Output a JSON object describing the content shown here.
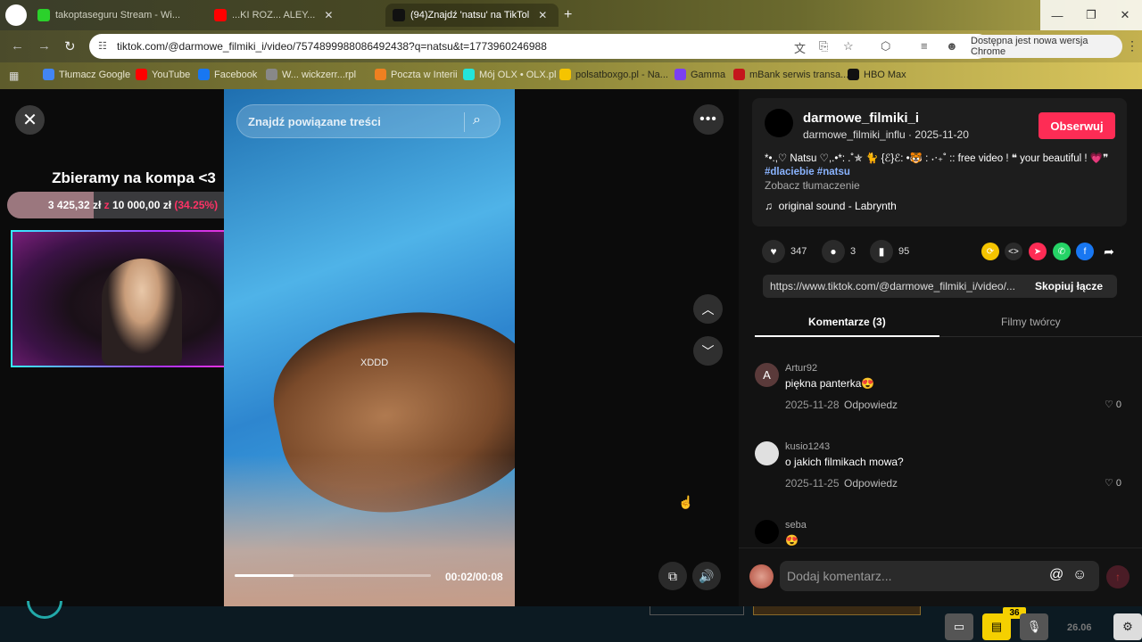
{
  "browser": {
    "tabs": [
      {
        "title": "takoptaseguru Stream - Wi...",
        "fav_color": "#2bd12b"
      },
      {
        "title": "...KI ROZ... ALEY...",
        "fav_color": "#ff0000"
      },
      {
        "title": "(94)Znajdź 'natsu' na TikTol",
        "fav_color": "#111111"
      }
    ],
    "url": "tiktok.com/@darmowe_filmiki_i/video/7574899988086492438?q=natsu&t=1773960246988",
    "update_label": "Dostępna jest nowa wersja Chrome",
    "bookmarks": [
      {
        "label": "Tłumacz Google",
        "color": "#4285f4"
      },
      {
        "label": "YouTube",
        "color": "#ff0000"
      },
      {
        "label": "Facebook",
        "color": "#1877f2"
      },
      {
        "label": "W... wickzerr...rpl",
        "color": "#888888"
      },
      {
        "label": "Poczta w Interii",
        "color": "#f08020"
      },
      {
        "label": "Mój OLX • OLX.pl",
        "color": "#23e5db"
      },
      {
        "label": "polsatboxgo.pl - Na...",
        "color": "#f5c400"
      },
      {
        "label": "Gamma",
        "color": "#7b3ff2"
      },
      {
        "label": "mBank serwis transa...",
        "color": "#c4161c"
      },
      {
        "label": "HBO Max",
        "color": "#111111"
      }
    ]
  },
  "overlay": {
    "donate_title": "Zbieramy na kompa <3",
    "donate_current": "3 425,32 zł",
    "donate_sep": "z",
    "donate_target": "10 000,00 zł",
    "donate_pct": "(34.25%)",
    "donate_progress": 0.3425
  },
  "video": {
    "search_placeholder": "Znajdź powiązane treści",
    "caption": "XDDD",
    "time": "00:02/00:08",
    "progress": 0.3
  },
  "post": {
    "author_name": "darmowe_filmiki_i",
    "author_handle": "darmowe_filmiki_influ",
    "date": "2025-11-20",
    "follow_label": "Obserwuj",
    "description": "*•.,♡ Natsu ♡,.•*: .˚✯ 🐈 {ℰ}ℰ: •🐯 : ˖‧₊˚ :: free video ! ❝ your beautiful ! 💗❞",
    "hashtags": "#dlaciebie #natsu",
    "translate": "Zobacz tłumaczenie",
    "sound": "original sound - Labrynth",
    "likes": "347",
    "comments_count": "3",
    "saves": "95",
    "link": "https://www.tiktok.com/@darmowe_filmiki_i/video/...",
    "copy_label": "Skopiuj łącze"
  },
  "panel_tabs": {
    "comments": "Komentarze (3)",
    "creator": "Filmy twórcy"
  },
  "comments": [
    {
      "initial": "A",
      "avatar_color": "#5a3a3a",
      "user": "Artur92",
      "text": "piękna panterka😍",
      "date": "2025-11-28",
      "reply": "Odpowiedz",
      "likes": "0"
    },
    {
      "initial": "",
      "avatar_color": "#e0e0e0",
      "user": "kusio1243",
      "text": "o jakich filmikach mowa?",
      "date": "2025-11-25",
      "reply": "Odpowiedz",
      "likes": "0"
    },
    {
      "initial": "",
      "avatar_color": "#000000",
      "user": "seba",
      "text": "😍",
      "date": "",
      "reply": "",
      "likes": ""
    }
  ],
  "comment_box": {
    "placeholder": "Dodaj komentarz..."
  },
  "tray": {
    "badge": "36",
    "date": "26.06"
  }
}
